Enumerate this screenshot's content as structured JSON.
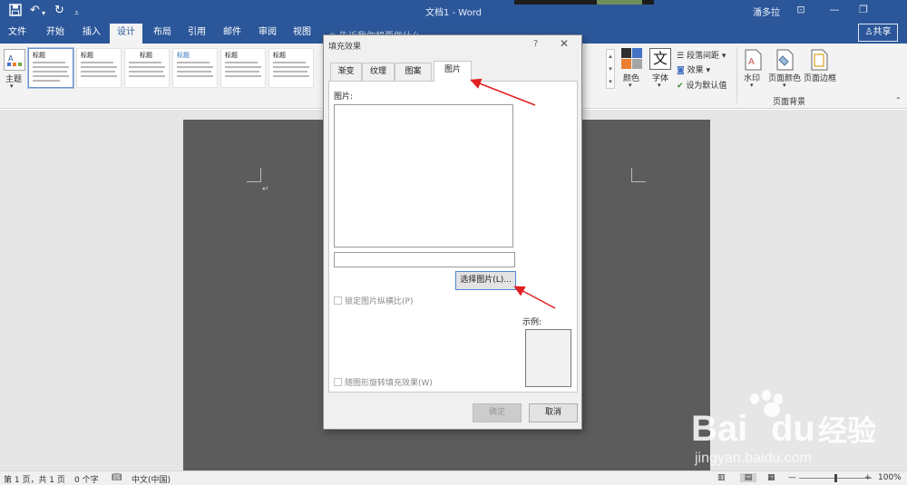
{
  "window": {
    "title": "文档1 - Word",
    "user": "潘多拉",
    "quick_access": {
      "save": "save-icon",
      "undo": "undo-icon",
      "redo": "redo-icon",
      "customize": "customize-icon"
    },
    "controls": {
      "restore_ribbon": "⊡",
      "minimize": "—",
      "maximize": "❐"
    }
  },
  "tabs": [
    "文件",
    "开始",
    "插入",
    "设计",
    "布局",
    "引用",
    "邮件",
    "审阅",
    "视图"
  ],
  "active_tab": "设计",
  "tell_me": "告诉我你想要做什么",
  "share": "共享",
  "ribbon": {
    "theme": "主题",
    "style_title": "标题",
    "style_heading": "标题 1",
    "colors": "颜色",
    "fonts": "字体",
    "paragraph_spacing": "段落间距",
    "effects": "效果",
    "set_default": "设为默认值",
    "watermark": "水印",
    "page_color": "页面颜色",
    "page_border": "页面边框",
    "page_background_group": "页面背景"
  },
  "dialog": {
    "title": "填充效果",
    "help": "?",
    "close": "✕",
    "tabs": [
      "渐变",
      "纹理",
      "图案",
      "图片"
    ],
    "active_tab": "图片",
    "picture_label": "图片:",
    "file_value": "",
    "select_button": "选择图片(L)...",
    "lock_aspect": "锁定图片纵横比(P)",
    "rotate_with_shape": "随图形旋转填充效果(W)",
    "sample_label": "示例:",
    "ok": "确定",
    "cancel": "取消"
  },
  "status_bar": {
    "page": "第 1 页，共 1 页",
    "words": "0 个字",
    "language": "中文(中国)",
    "zoom": "100%",
    "zoom_level": 1.0
  },
  "watermark": {
    "brand": "Bai du 经验",
    "url": "jingyan.baidu.com"
  },
  "colors": {
    "title_bar": "#2b579a",
    "annotation_arrow": "#e02020"
  }
}
